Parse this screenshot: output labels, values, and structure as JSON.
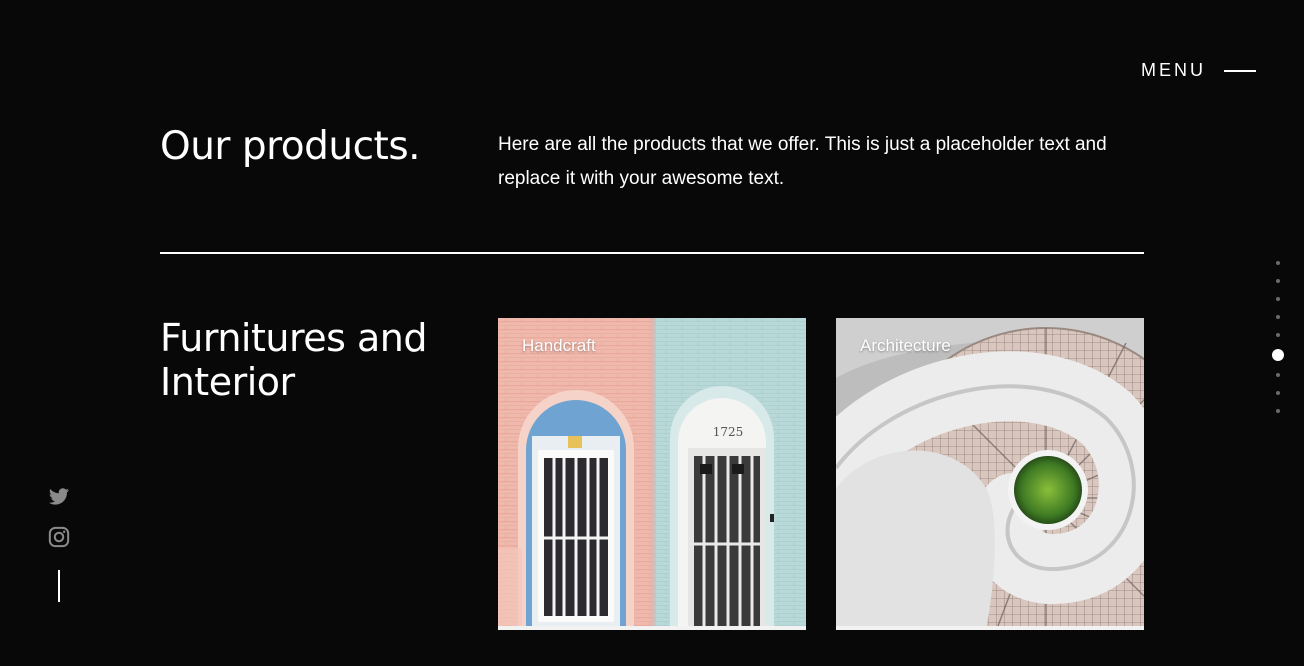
{
  "menu": {
    "label": "MENU"
  },
  "header": {
    "title": "Our products.",
    "intro": "Here are all the products that we offer. This is just a placeholder text and replace it with your awesome text."
  },
  "section": {
    "title": "Furnitures and Interior"
  },
  "cards": [
    {
      "label": "Handcraft",
      "door_number": "1725"
    },
    {
      "label": "Architecture"
    }
  ],
  "social": {
    "icons": [
      "twitter-icon",
      "instagram-icon"
    ]
  },
  "pagination": {
    "total": 9,
    "active_index": 5
  },
  "colors": {
    "background": "#080808",
    "text": "#ffffff",
    "inactive_dot": "#6a6a6a"
  }
}
